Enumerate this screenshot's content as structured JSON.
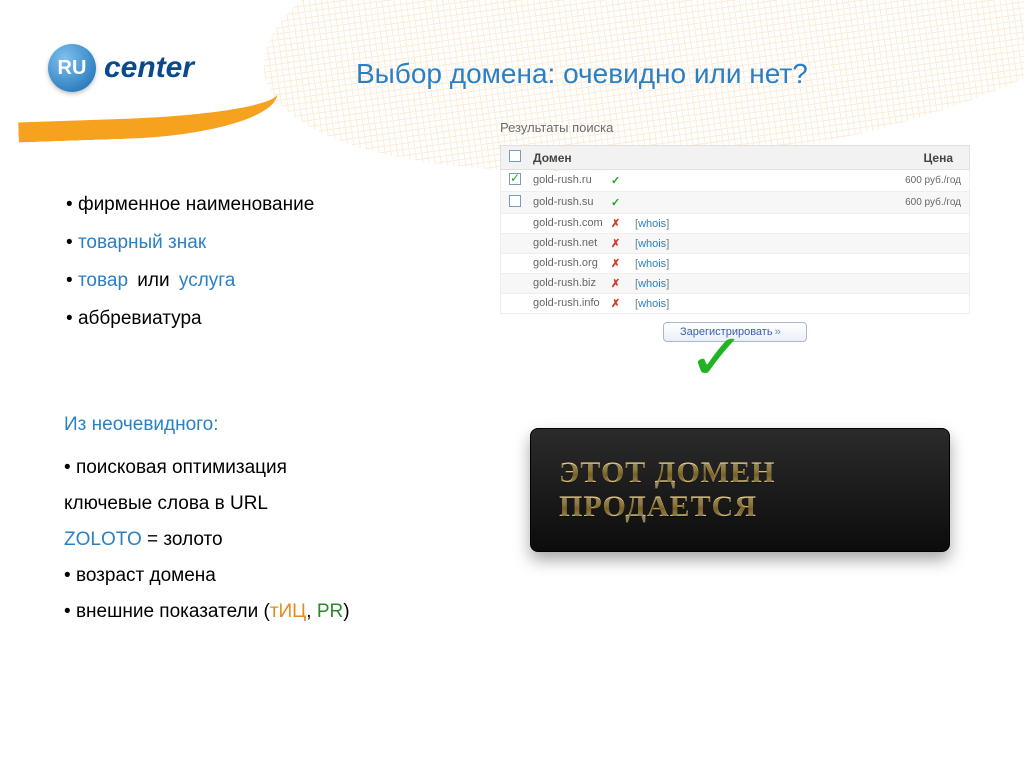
{
  "logo": {
    "ru": "RU",
    "text": "center"
  },
  "title": "Выбор домена: очевидно или нет?",
  "obvious": {
    "items": [
      "фирменное наименование"
    ]
  },
  "obvious_more": {
    "tm": "товарный знак",
    "good": "товар",
    "or": "или",
    "service": "услуга",
    "abbrev": "аббревиатура"
  },
  "nonobvious": {
    "heading": "Из неочевидного:",
    "seo": "поисковая оптимизация",
    "keywords": "ключевые слова в URL",
    "zoloto_lat": "ZOLOTO",
    "zoloto_eq": " = золото",
    "age": "возраст домена",
    "extern_lead": "внешние показатели (",
    "tic": "тИЦ",
    "comma": ", ",
    "pr": "PR",
    "close": ")"
  },
  "search": {
    "heading": "Результаты поиска",
    "col_domain": "Домен",
    "col_price": "Цена",
    "whois_open": "[",
    "whois": "whois",
    "whois_close": "]",
    "register": "Зарегистрировать",
    "rows": [
      {
        "domain": "gold-rush.ru",
        "checked": true,
        "status": "ok",
        "price": "600 руб./год"
      },
      {
        "domain": "gold-rush.su",
        "checked": false,
        "status": "ok",
        "price": "600 руб./год"
      },
      {
        "domain": "gold-rush.com",
        "checked": null,
        "status": "bad",
        "price": ""
      },
      {
        "domain": "gold-rush.net",
        "checked": null,
        "status": "bad",
        "price": ""
      },
      {
        "domain": "gold-rush.org",
        "checked": null,
        "status": "bad",
        "price": ""
      },
      {
        "domain": "gold-rush.biz",
        "checked": null,
        "status": "bad",
        "price": ""
      },
      {
        "domain": "gold-rush.info",
        "checked": null,
        "status": "bad",
        "price": ""
      }
    ]
  },
  "banner": {
    "line1": "ЭТОТ ДОМЕН",
    "line2": "ПРОДАЕТСЯ"
  }
}
